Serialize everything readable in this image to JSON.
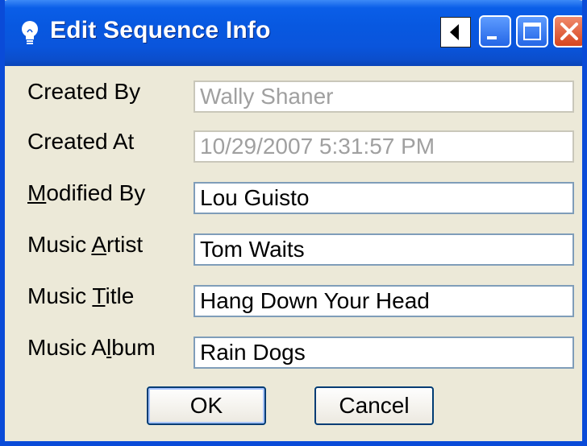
{
  "window": {
    "title": "Edit Sequence Info"
  },
  "fields": [
    {
      "label_pre": "Created By",
      "label_ul": "",
      "label_post": "",
      "value": "Wally Shaner",
      "enabled": false
    },
    {
      "label_pre": "Created At",
      "label_ul": "",
      "label_post": "",
      "value": "10/29/2007 5:31:57 PM",
      "enabled": false
    },
    {
      "label_pre": "",
      "label_ul": "M",
      "label_post": "odified By",
      "value": "Lou Guisto",
      "enabled": true
    },
    {
      "label_pre": "Music ",
      "label_ul": "A",
      "label_post": "rtist",
      "value": "Tom Waits",
      "enabled": true
    },
    {
      "label_pre": "Music ",
      "label_ul": "T",
      "label_post": "itle",
      "value": "Hang Down Your Head",
      "enabled": true
    },
    {
      "label_pre": "Music A",
      "label_ul": "l",
      "label_post": "bum",
      "value": "Rain Dogs",
      "enabled": true
    }
  ],
  "buttons": {
    "ok_label": "OK",
    "cancel_label": "Cancel"
  },
  "icons": {
    "title": "lightbulb-icon",
    "help": "help-arrow-icon",
    "minimize": "minimize-icon",
    "maximize": "maximize-icon",
    "close": "close-icon"
  },
  "colors": {
    "titlebar": "#0a55dc",
    "dialog_bg": "#ece9d8",
    "disabled_text": "#a0a0a0",
    "close_button": "#d6451f"
  }
}
